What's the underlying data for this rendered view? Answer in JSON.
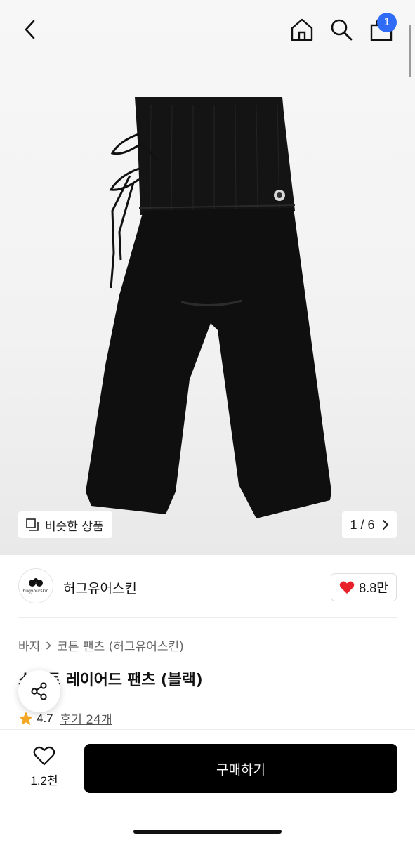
{
  "header": {
    "back_icon": "chevron-left-icon",
    "home_icon": "home-icon",
    "search_icon": "search-icon",
    "cart_icon": "shopping-bag-icon",
    "cart_count": "1",
    "badge_color": "#2f6bf5"
  },
  "gallery": {
    "similar_label": "비슷한 상품",
    "similar_icon": "stack-squares-icon",
    "page_indicator": "1 / 6",
    "next_icon": "chevron-right-icon"
  },
  "brand": {
    "name": "허그유어스킨",
    "logo_text": "hugyourskin",
    "like_count": "8.8만",
    "heart_color": "#e8202a"
  },
  "breadcrumb": {
    "category": "바지",
    "subcategory": "코튼 팬츠 (허그유어스킨)"
  },
  "product": {
    "title": "스커트 레이어드 팬츠 (블랙)",
    "rating": "4.7",
    "reviews": "후기 24개",
    "star_color": "#f5a623"
  },
  "bottom": {
    "wish_count": "1.2천",
    "buy_label": "구매하기"
  }
}
